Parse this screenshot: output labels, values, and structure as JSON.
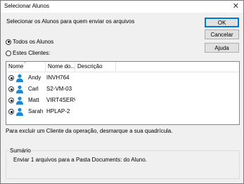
{
  "window": {
    "title": "Selecionar Alunos"
  },
  "instruction": "Selecionar os Alunos para quem enviar os arquivos",
  "buttons": {
    "ok": "OK",
    "cancel": "Cancelar",
    "help": "Ajuda"
  },
  "options": {
    "all_students": "Todos os Alunos",
    "these_clients": "Estes Clientes:",
    "selected": "all_students"
  },
  "table": {
    "columns": [
      "Nome",
      "Nome do...",
      "Descrição"
    ],
    "rows": [
      {
        "name": "Andy",
        "machine": "INVH764",
        "description": ""
      },
      {
        "name": "Carl",
        "machine": "S2-VM-03",
        "description": ""
      },
      {
        "name": "Matt",
        "machine": "VIRT4SERV...",
        "description": ""
      },
      {
        "name": "Sarah",
        "machine": "HPLAP-2",
        "description": ""
      }
    ]
  },
  "note": "Para excluir um Cliente da operação, desmarque a sua quadrícula.",
  "summary": {
    "label": "Sumário",
    "text": "Enviar 1 arquivos para a Pasta Documents: do Aluno."
  },
  "colors": {
    "accent": "#0078d7",
    "user_icon": "#1e88d4"
  },
  "icons": {
    "user": "user-icon",
    "close": "close-icon"
  }
}
